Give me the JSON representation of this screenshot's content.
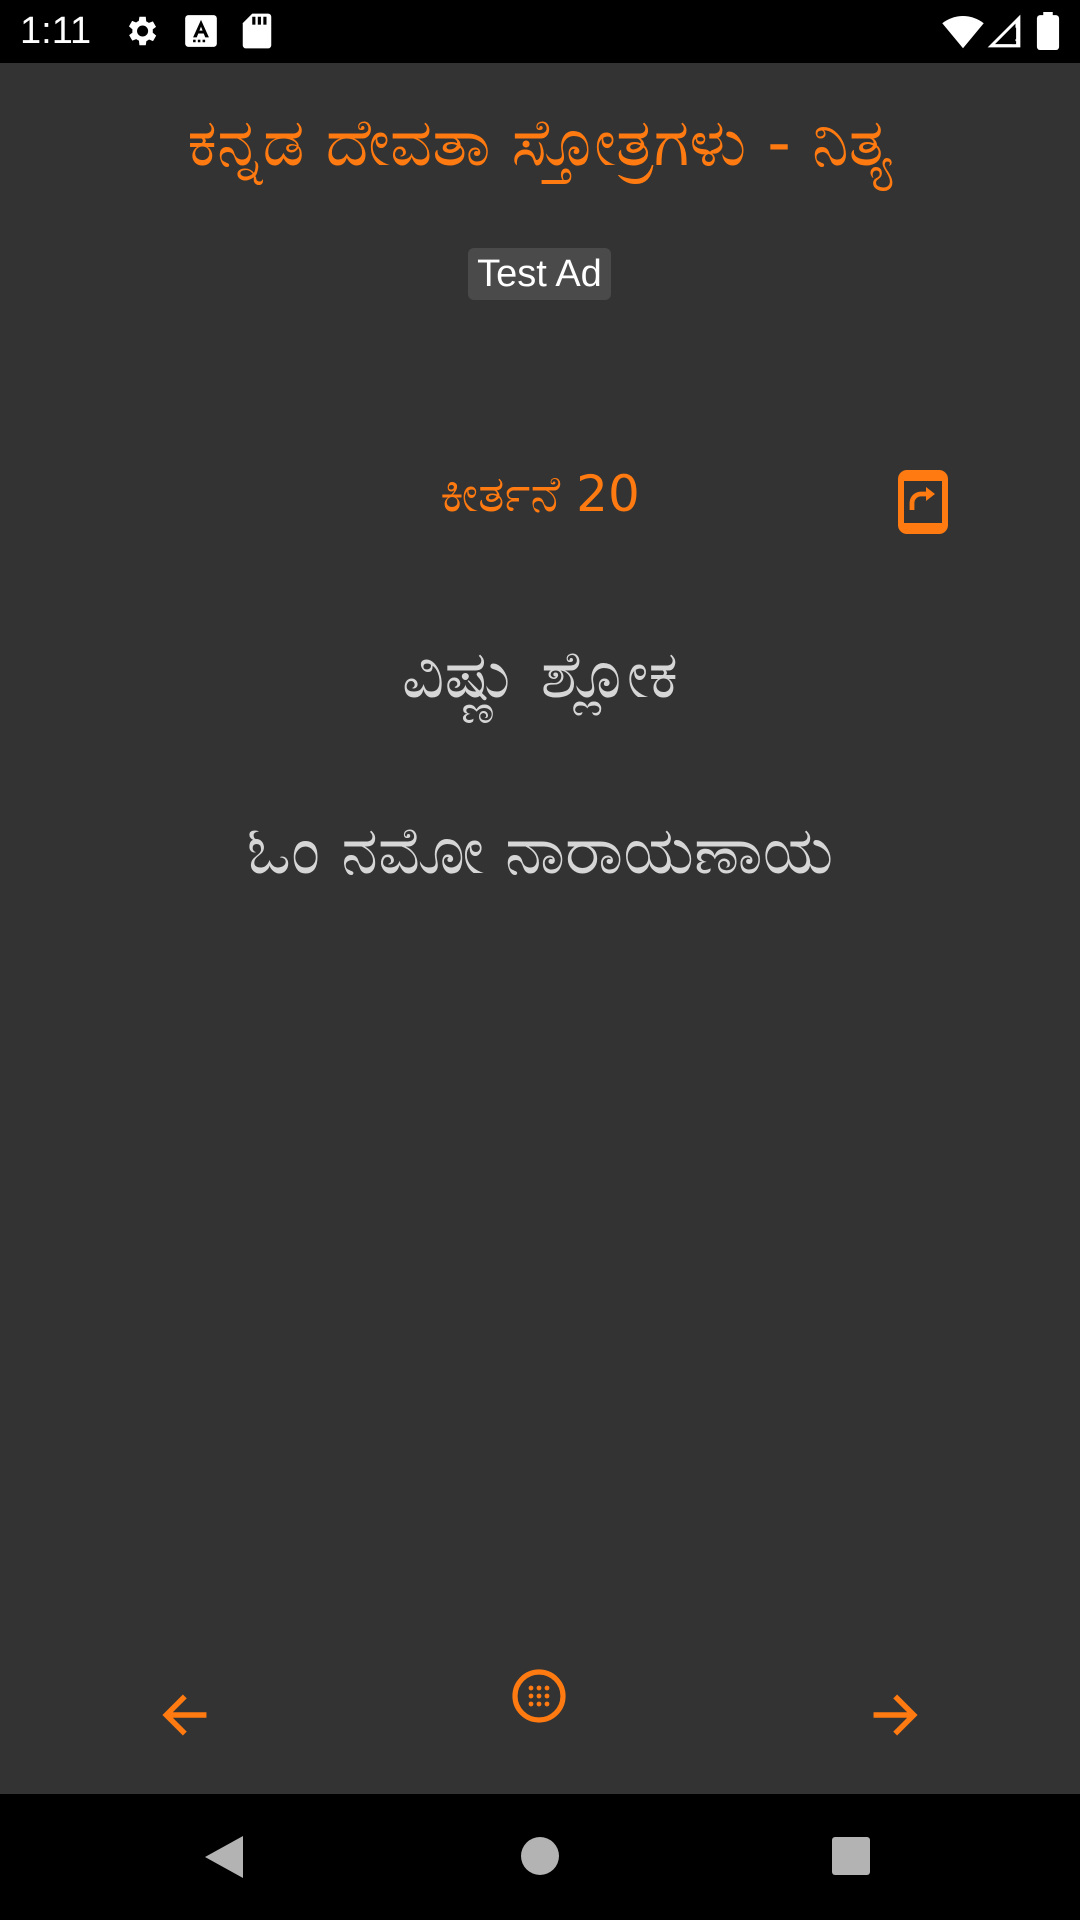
{
  "status_bar": {
    "time": "1:11",
    "icons": [
      "settings-icon",
      "keyboard-a-icon",
      "sd-card-icon",
      "wifi-icon",
      "signal-icon",
      "battery-icon"
    ]
  },
  "app": {
    "title": "ಕನ್ನಡ ದೇವತಾ ಸ್ತೋತ್ರಗಳು - ನಿತ್ಯ",
    "accent_color": "#ff7a10",
    "background_color": "#333333"
  },
  "ad": {
    "label": "Test Ad"
  },
  "content": {
    "heading": "ಕೀರ್ತನೆ 20",
    "verses": [
      "ವಿಷ್ಣು ಶ್ಲೋಕ",
      "ಓಂ ನಮೋ ನಾರಾಯಣಾಯ"
    ]
  },
  "controls": {
    "share": "share-icon",
    "prev": "arrow-left-icon",
    "menu": "grid-menu-icon",
    "next": "arrow-right-icon"
  },
  "system_nav": {
    "back": "back-icon",
    "home": "home-icon",
    "recent": "recent-apps-icon"
  }
}
